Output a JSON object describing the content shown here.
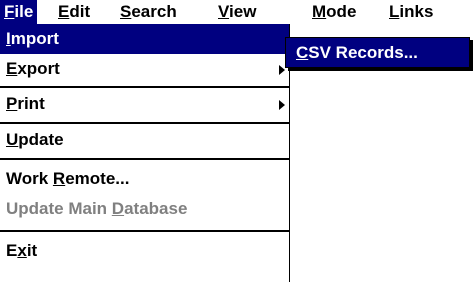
{
  "menubar": {
    "items": [
      {
        "label": "File",
        "mnemonic": "F"
      },
      {
        "label": "Edit",
        "mnemonic": "E"
      },
      {
        "label": "Search",
        "mnemonic": "S"
      },
      {
        "label": "View",
        "mnemonic": "V"
      },
      {
        "label": "Mode",
        "mnemonic": "M"
      },
      {
        "label": "Links",
        "mnemonic": "L"
      }
    ]
  },
  "file_menu": {
    "items": [
      {
        "label": "Import",
        "mnemonic": "I"
      },
      {
        "label": "Export",
        "mnemonic": "E"
      },
      {
        "label": "Print",
        "mnemonic": "P"
      },
      {
        "label": "Update",
        "mnemonic": "U"
      },
      {
        "label": "Work Remote...",
        "mnemonic": "R"
      },
      {
        "label": "Update Main Database",
        "mnemonic": "D"
      },
      {
        "label": "Exit",
        "mnemonic": "x"
      }
    ]
  },
  "import_submenu": {
    "items": [
      {
        "label": "CSV Records...",
        "mnemonic": "C"
      }
    ]
  },
  "colors": {
    "highlight": "#000080",
    "disabled_text": "#808080"
  }
}
